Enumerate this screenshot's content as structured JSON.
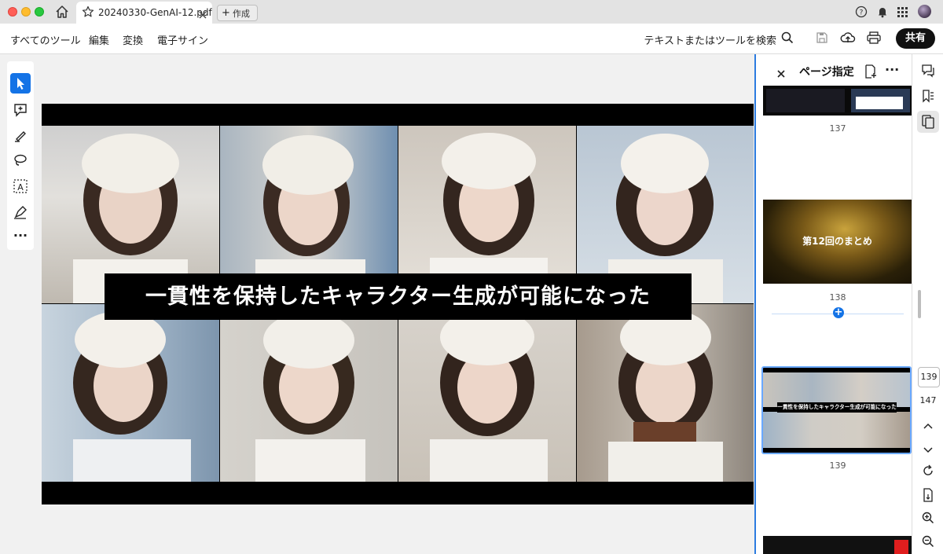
{
  "window": {
    "tab_title": "20240330-GenAI-12.pdf",
    "new_tab_label": "作成"
  },
  "menu": {
    "items": [
      "すべてのツール",
      "編集",
      "変換",
      "電子サイン"
    ],
    "search_label": "テキストまたはツールを検索",
    "share_label": "共有"
  },
  "slide": {
    "caption": "一貫性を保持したキャラクター生成が可能になった"
  },
  "panel": {
    "title": "ページ指定",
    "thumbnails": [
      {
        "page": "137"
      },
      {
        "page": "138",
        "text": "第12回のまとめ"
      },
      {
        "page": "139",
        "text": "一貫性を保持したキャラクター生成が可能になった"
      }
    ]
  },
  "navigation": {
    "current_page": "139",
    "total_pages": "147"
  },
  "icons": {
    "home": "home-icon",
    "star": "star-icon",
    "close": "close-icon",
    "help": "help-icon",
    "bell": "bell-icon",
    "apps": "apps-grid-icon",
    "search": "search-icon",
    "save": "save-icon",
    "upload": "cloud-upload-icon",
    "print": "print-icon"
  },
  "colors": {
    "accent": "#2c7ce0",
    "share_button": "#111111",
    "select_tool": "#1473e6"
  }
}
